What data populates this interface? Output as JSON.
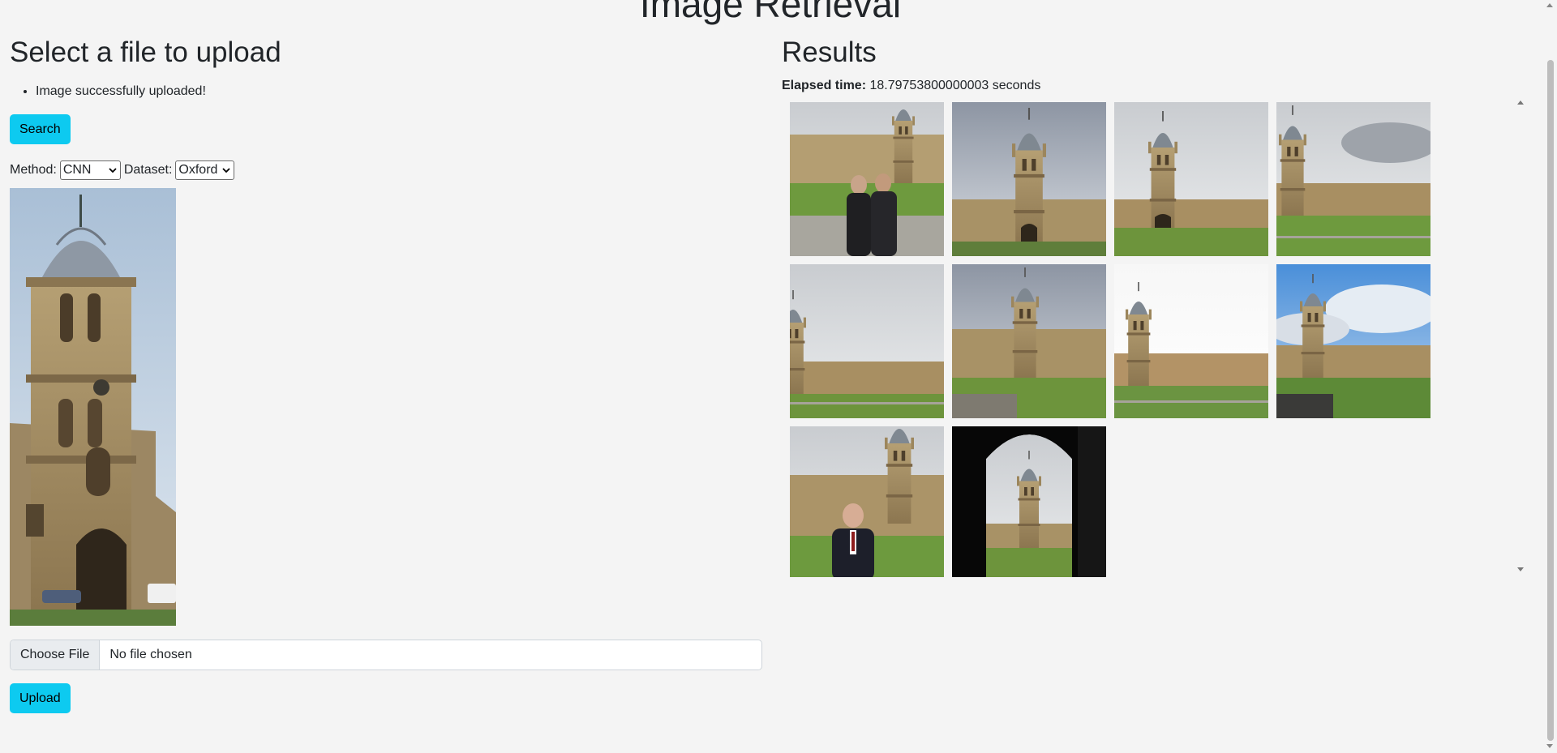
{
  "app": {
    "title": "Image Retrieval"
  },
  "upload": {
    "heading": "Select a file to upload",
    "messages": [
      "Image successfully uploaded!"
    ],
    "search_label": "Search",
    "method_label": "Method:",
    "method_value": "CNN",
    "dataset_label": "Dataset:",
    "dataset_value": "Oxford",
    "query_image_icon": "tom-tower-photo",
    "choose_file_label": "Choose File",
    "file_status": "No file chosen",
    "upload_label": "Upload"
  },
  "results": {
    "heading": "Results",
    "elapsed_label": "Elapsed time:",
    "elapsed_value": "18.79753800000003 seconds",
    "images": [
      {
        "kind": "couple-in-front"
      },
      {
        "kind": "tower-closeup"
      },
      {
        "kind": "tower-quad"
      },
      {
        "kind": "tower-left-quad"
      },
      {
        "kind": "wide-quad"
      },
      {
        "kind": "tower-lawn"
      },
      {
        "kind": "tower-bright"
      },
      {
        "kind": "tower-bluesky"
      },
      {
        "kind": "man-in-front"
      },
      {
        "kind": "archway-view"
      }
    ]
  },
  "colors": {
    "accent": "#0dcaf0",
    "background": "#f4f4f4"
  }
}
